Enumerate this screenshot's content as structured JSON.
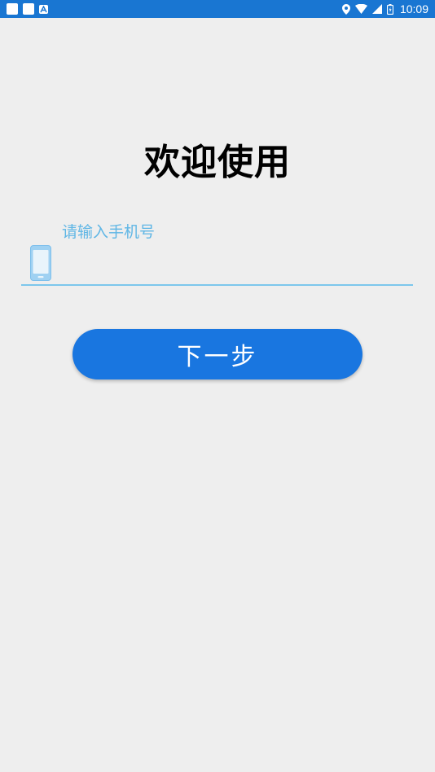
{
  "status_bar": {
    "time": "10:09",
    "icons": [
      "notification-square-icon",
      "notification-square-icon",
      "notification-a-icon",
      "location-icon",
      "wifi-icon",
      "signal-icon",
      "battery-icon"
    ]
  },
  "main": {
    "title": "欢迎使用",
    "phone_field": {
      "placeholder": "请输入手机号",
      "value": "",
      "icon": "phone-icon"
    },
    "next_button_label": "下一步"
  },
  "colors": {
    "status_bar": "#1976d2",
    "background": "#eeeeee",
    "accent": "#1976e0",
    "hint": "#5fb6e5",
    "underline": "#7cc6ec"
  }
}
